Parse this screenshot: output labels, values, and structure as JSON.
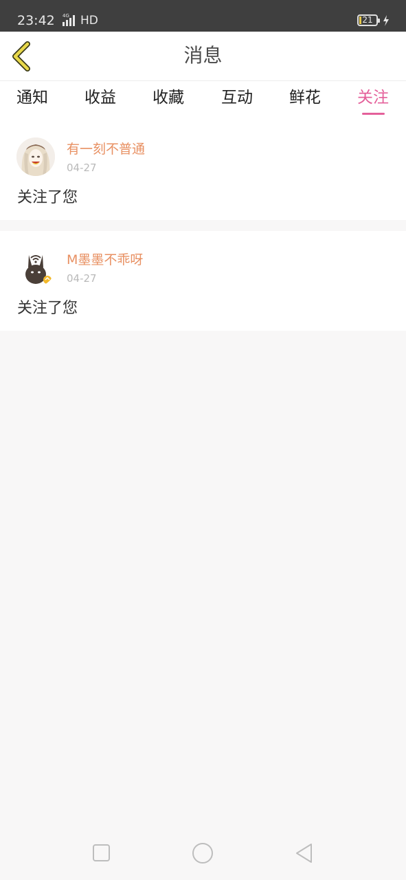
{
  "status_bar": {
    "time": "23:42",
    "network": "4G",
    "hd_label": "HD",
    "battery": "21",
    "charging_icon": "lightning-icon"
  },
  "header": {
    "title": "消息",
    "back_icon": "chevron-left-icon"
  },
  "tabs": [
    {
      "label": "通知",
      "active": false
    },
    {
      "label": "收益",
      "active": false
    },
    {
      "label": "收藏",
      "active": false
    },
    {
      "label": "互动",
      "active": false
    },
    {
      "label": "鲜花",
      "active": false
    },
    {
      "label": "关注",
      "active": true
    }
  ],
  "messages": [
    {
      "username": "有一刻不普通",
      "date": "04-27",
      "text": "关注了您"
    },
    {
      "username": "M墨墨不乖呀",
      "date": "04-27",
      "text": "关注了您"
    }
  ],
  "colors": {
    "accent": "#e4609a",
    "username": "#e89062",
    "back_arrow": "#e8d84a",
    "status_bar_bg": "#3f3f3f",
    "page_bg": "#f8f7f7"
  },
  "nav_bar": {
    "recents_icon": "square-icon",
    "home_icon": "circle-icon",
    "back_icon": "triangle-back-icon"
  }
}
